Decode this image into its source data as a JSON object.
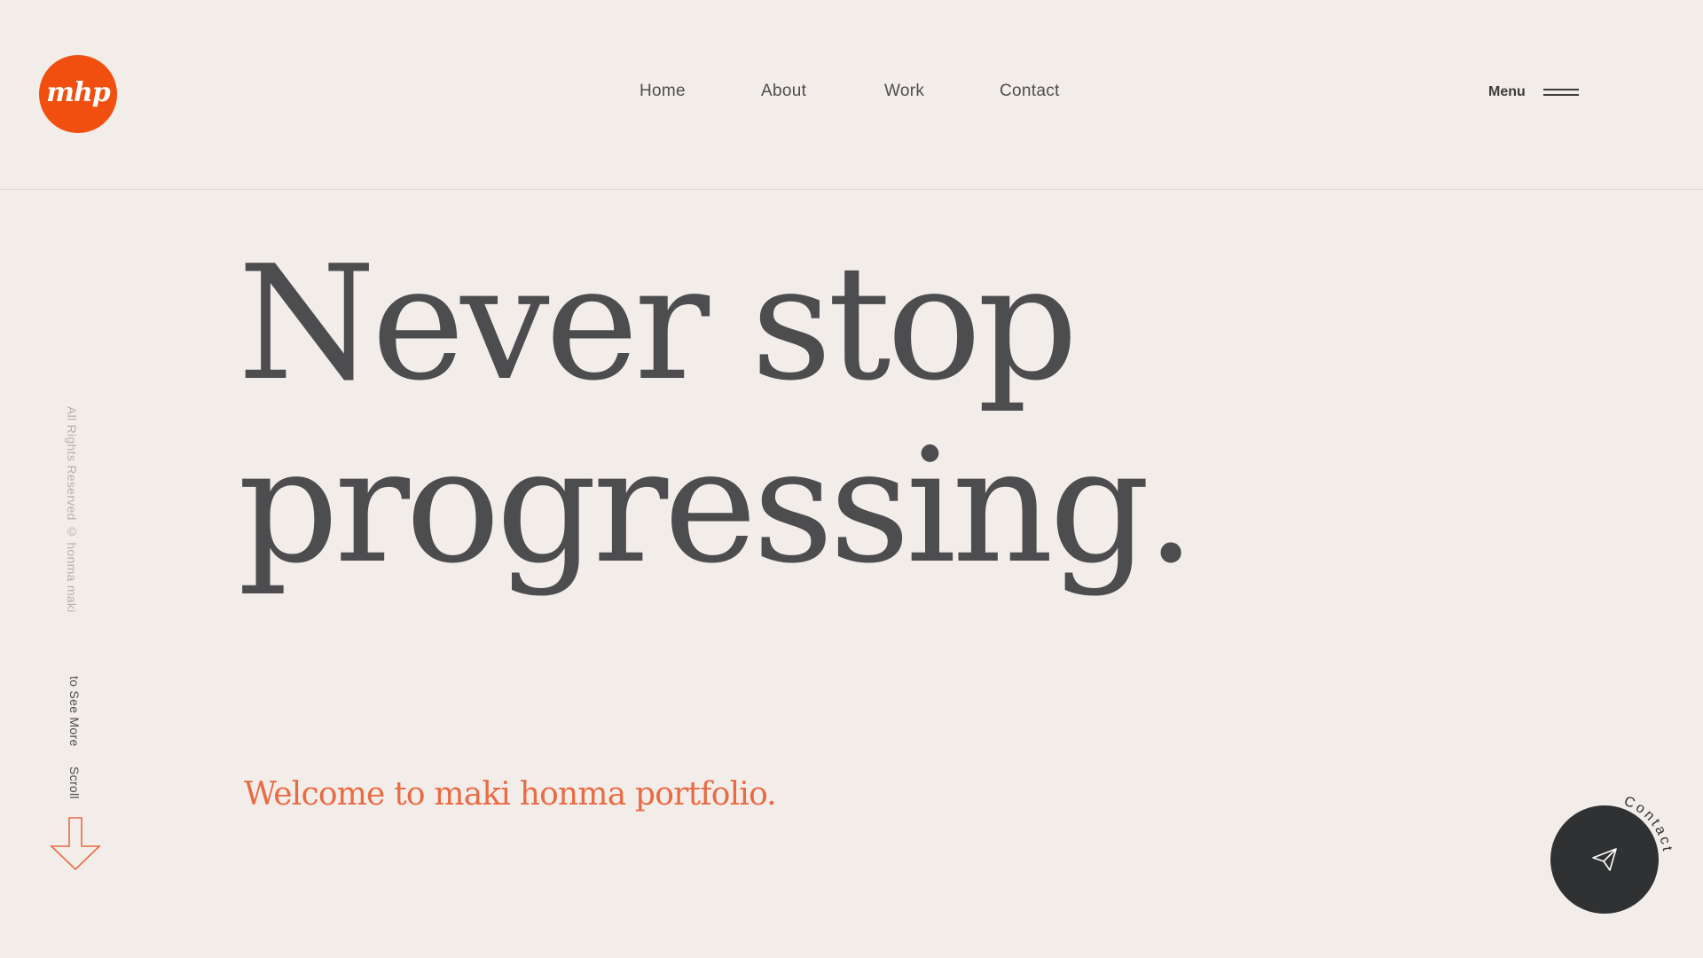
{
  "brand": {
    "logo_text": "mhp",
    "accent_color": "#f04f0f"
  },
  "nav": {
    "items": [
      {
        "label": "Home"
      },
      {
        "label": "About"
      },
      {
        "label": "Work"
      },
      {
        "label": "Contact"
      }
    ]
  },
  "menu": {
    "label": "Menu",
    "icon": "hamburger-icon"
  },
  "hero": {
    "title_line1": "Never stop",
    "title_line2": "progressing.",
    "tagline": "Welcome to maki honma portfolio.",
    "tagline_color": "#e86b45"
  },
  "sidebar": {
    "rights": "All Rights Reserved © honma maki",
    "scroll_part1": "Scroll",
    "scroll_part2": "to See More",
    "arrow_icon": "arrow-down-icon"
  },
  "contact_fab": {
    "label": "Contact",
    "icon": "paper-plane-icon",
    "bg_color": "#2f3133"
  }
}
